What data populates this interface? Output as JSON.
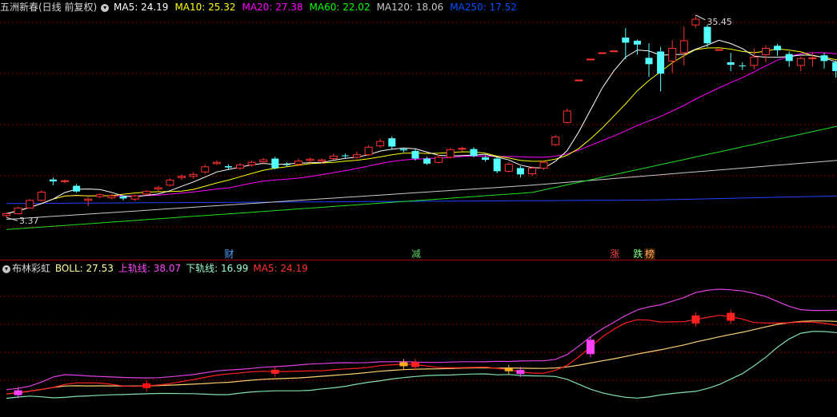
{
  "main_panel": {
    "title": "五洲新春(日线 前复权)",
    "ma_labels": [
      {
        "text": "MA5: 24.19",
        "color": "#ffffff"
      },
      {
        "text": "MA10: 25.32",
        "color": "#ffff00"
      },
      {
        "text": "MA20: 27.38",
        "color": "#ff00ff"
      },
      {
        "text": "MA60: 22.02",
        "color": "#00ff00"
      },
      {
        "text": "MA120: 18.06",
        "color": "#c8c8c8"
      },
      {
        "text": "MA250: 17.52",
        "color": "#0050ff"
      }
    ],
    "high_label": "35.45",
    "low_label": "3.37",
    "markers": [
      {
        "text": "财",
        "color": "#4da6ff"
      },
      {
        "text": "减",
        "color": "#5fd35f"
      },
      {
        "text": "涨",
        "color": "#ff4040"
      },
      {
        "text": "跌",
        "color": "#7fff7f"
      },
      {
        "text": "榜",
        "color": "#ffb060"
      }
    ]
  },
  "sub_panel": {
    "title": "布林彩虹",
    "labels": [
      {
        "text": "BOLL: 27.53",
        "color": "#ffff9c"
      },
      {
        "text": "上轨线: 38.07",
        "color": "#ff44ff"
      },
      {
        "text": "下轨线: 16.99",
        "color": "#9cffd0"
      },
      {
        "text": "MA5: 24.19",
        "color": "#ff3030"
      }
    ]
  },
  "colors": {
    "up": "#ff3232",
    "down": "#54ffff",
    "grid": "#8b0000"
  },
  "chart_data": {
    "type": "candlestick",
    "series": [
      {
        "name": "K",
        "values": [
          [
            3.8,
            4.1,
            3.5,
            4.3
          ],
          [
            4.1,
            5.0,
            4.0,
            5.2
          ],
          [
            5.0,
            6.2,
            4.9,
            6.4
          ],
          [
            6.2,
            7.5,
            6.0,
            7.8
          ],
          [
            9.5,
            9.2,
            8.6,
            9.8
          ],
          [
            9.2,
            9.3,
            8.9,
            9.5
          ],
          [
            8.5,
            7.6,
            7.4,
            8.8
          ],
          [
            6.2,
            6.4,
            5.3,
            6.7
          ],
          [
            6.8,
            7.1,
            6.5,
            7.3
          ],
          [
            6.6,
            6.9,
            6.4,
            7.2
          ],
          [
            6.8,
            6.5,
            6.2,
            7.0
          ],
          [
            6.4,
            6.9,
            6.1,
            7.1
          ],
          [
            7.2,
            7.6,
            7.0,
            7.8
          ],
          [
            8.0,
            8.2,
            7.7,
            8.5
          ],
          [
            8.6,
            9.4,
            8.4,
            9.7
          ],
          [
            9.8,
            10.0,
            9.4,
            10.3
          ],
          [
            10.0,
            10.3,
            9.6,
            10.7
          ],
          [
            10.7,
            11.5,
            10.4,
            11.9
          ],
          [
            12.0,
            12.2,
            11.8,
            12.5
          ],
          [
            11.6,
            11.4,
            11.1,
            11.9
          ],
          [
            11.3,
            11.8,
            11.0,
            12.1
          ],
          [
            11.8,
            12.2,
            11.5,
            12.5
          ],
          [
            12.3,
            12.6,
            11.9,
            12.9
          ],
          [
            12.8,
            11.3,
            11.1,
            13.1
          ],
          [
            11.9,
            11.8,
            11.5,
            12.2
          ],
          [
            11.9,
            12.4,
            11.6,
            12.8
          ],
          [
            12.5,
            12.7,
            12.1,
            13.0
          ],
          [
            12.4,
            12.6,
            12.0,
            12.8
          ],
          [
            12.8,
            13.2,
            12.6,
            13.6
          ],
          [
            13.3,
            13.2,
            12.8,
            13.6
          ],
          [
            13.0,
            13.4,
            12.8,
            13.9
          ],
          [
            13.4,
            14.6,
            13.2,
            14.9
          ],
          [
            14.8,
            15.5,
            14.5,
            15.9
          ],
          [
            16.0,
            14.7,
            14.2,
            16.3
          ],
          [
            14.3,
            14.1,
            13.8,
            14.5
          ],
          [
            14.0,
            12.8,
            12.5,
            14.3
          ],
          [
            12.8,
            12.0,
            11.8,
            13.1
          ],
          [
            12.2,
            13.0,
            12.0,
            13.4
          ],
          [
            13.0,
            14.2,
            12.8,
            14.5
          ],
          [
            14.3,
            14.4,
            14.0,
            14.7
          ],
          [
            14.3,
            13.2,
            13.0,
            14.6
          ],
          [
            13.0,
            12.6,
            12.3,
            13.3
          ],
          [
            12.8,
            10.8,
            10.5,
            13.0
          ],
          [
            10.8,
            11.9,
            10.6,
            12.2
          ],
          [
            11.3,
            10.3,
            9.8,
            11.6
          ],
          [
            10.4,
            11.3,
            10.1,
            11.6
          ],
          [
            11.3,
            12.2,
            11.0,
            12.5
          ],
          [
            15.0,
            16.2,
            14.8,
            16.5
          ],
          [
            18.5,
            20.3,
            18.3,
            20.7
          ],
          [
            25.2,
            25.2,
            25.2,
            25.2
          ],
          [
            28.5,
            28.5,
            28.5,
            28.5
          ],
          [
            29.5,
            29.5,
            29.5,
            29.5
          ],
          [
            29.8,
            29.8,
            29.8,
            29.8
          ],
          [
            31.9,
            31.1,
            28.5,
            33.4
          ],
          [
            31.4,
            30.8,
            29.2,
            31.6
          ],
          [
            28.7,
            27.7,
            25.7,
            31.0
          ],
          [
            29.7,
            26.2,
            23.4,
            30.4
          ],
          [
            28.2,
            30.2,
            26.3,
            31.5
          ],
          [
            29.5,
            31.4,
            27.5,
            33.6
          ],
          [
            33.9,
            34.8,
            33.5,
            35.45
          ],
          [
            33.6,
            31.0,
            30.4,
            33.9
          ],
          [
            30.0,
            30.0,
            30.0,
            30.0
          ],
          [
            28.0,
            27.6,
            26.6,
            29.5
          ],
          [
            27.5,
            27.4,
            26.8,
            28.0
          ],
          [
            27.5,
            28.8,
            26.9,
            30.2
          ],
          [
            29.2,
            30.2,
            28.0,
            30.7
          ],
          [
            30.6,
            29.9,
            29.0,
            30.9
          ],
          [
            29.3,
            28.2,
            27.3,
            29.7
          ],
          [
            27.5,
            28.6,
            26.6,
            28.9
          ],
          [
            28.6,
            28.7,
            27.3,
            29.6
          ],
          [
            29.1,
            28.2,
            27.0,
            29.5
          ],
          [
            28.0,
            26.6,
            25.6,
            28.3
          ],
          [
            26.3,
            25.3,
            24.2,
            26.6
          ],
          [
            24.6,
            25.4,
            23.9,
            25.9
          ],
          [
            25.2,
            23.6,
            23.0,
            25.4
          ],
          [
            23.3,
            23.6,
            22.8,
            23.8
          ],
          [
            23.5,
            24.0,
            23.4,
            24.2
          ],
          [
            24.1,
            24.4,
            23.8,
            24.8
          ]
        ]
      }
    ]
  }
}
